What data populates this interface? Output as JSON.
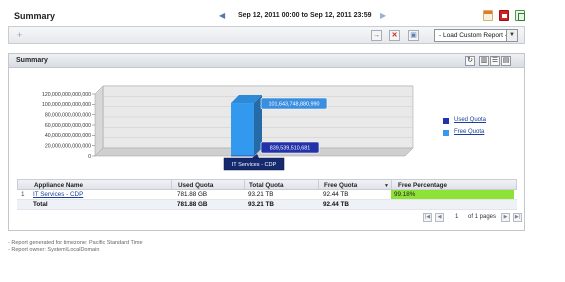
{
  "header": {
    "title": "Summary",
    "date_range": "Sep 12, 2011 00:00 to Sep 12, 2011 23:59"
  },
  "filter_bar": {
    "add_symbol": "+",
    "load_custom_report": "- Load Custom Report -"
  },
  "panel": {
    "title": "Summary"
  },
  "chart_data": {
    "type": "bar",
    "stacked": true,
    "three_d": true,
    "categories": [
      "IT Services - CDP"
    ],
    "series": [
      {
        "name": "Used Quota",
        "values": [
          839539510681
        ],
        "color": "#2233aa"
      },
      {
        "name": "Free Quota",
        "values": [
          101643748880990
        ],
        "color": "#3399ee"
      }
    ],
    "data_labels": [
      "101,643,748,880,990",
      "839,539,510,681"
    ],
    "tooltip": "IT Services - CDP",
    "ylim": [
      0,
      120000000000000
    ],
    "yticks": [
      0,
      20000000000000,
      40000000000000,
      60000000000000,
      80000000000000,
      100000000000000,
      120000000000000
    ],
    "ytick_labels": [
      "0",
      "20,000,000,000,000",
      "40,000,000,000,000",
      "60,000,000,000,000",
      "80,000,000,000,000",
      "100,000,000,000,000",
      "120,000,000,000,000"
    ],
    "legend_position": "right",
    "grid": true
  },
  "table": {
    "columns": [
      "Appliance Name",
      "Used Quota",
      "Total Quota",
      "Free Quota",
      "Free Percentage"
    ],
    "rows": [
      {
        "index": "1",
        "name": "IT Services - CDP",
        "used": "781.88 GB",
        "total": "93.21 TB",
        "free": "92.44 TB",
        "percentage": "99.18%",
        "percentage_value": 99.18
      }
    ],
    "total_row": {
      "label": "Total",
      "used": "781.88 GB",
      "total": "93.21 TB",
      "free": "92.44 TB"
    }
  },
  "pager": {
    "page": "1",
    "of_pages": "of 1 pages"
  },
  "footer": {
    "line1": "- Report generated for timezone: Pacific Standard Time",
    "line2": "- Report owner: System\\LocalDomain"
  },
  "colors": {
    "used": "#2233aa",
    "free": "#3399ee",
    "percent_bar": "#8ee236"
  }
}
